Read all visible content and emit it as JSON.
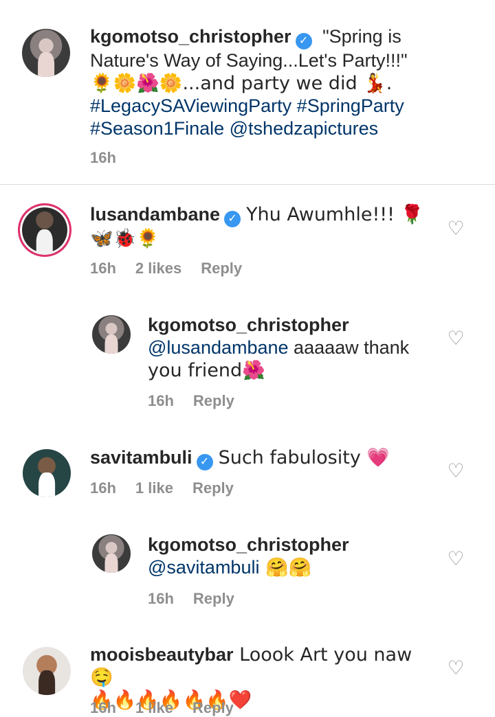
{
  "caption": {
    "username": "kgomotso_christopher",
    "text_line1": "\"Spring is",
    "text_line2": "Nature's Way of Saying...Let's Party!!!\"",
    "emoji_line": "🌻🌼🌺🌼...and party we did 💃.",
    "hashtags_line1": "#LegacySAViewingParty #SpringParty",
    "hashtags_line2": "#Season1Finale @tshedzapictures",
    "time": "16h"
  },
  "comments": [
    {
      "username": "lusandambane",
      "text": "Yhu Awumhle!!! 🌹",
      "text2": "🦋🐞🌻",
      "time": "16h",
      "likes": "2 likes",
      "reply": "Reply"
    },
    {
      "username": "kgomotso_christopher",
      "mention": "@lusandambane",
      "text": " aaaaaw thank",
      "text2": "you friend🌺",
      "time": "16h",
      "reply": "Reply"
    },
    {
      "username": "savitambuli",
      "text": "Such fabulosity 💗",
      "time": "16h",
      "likes": "1 like",
      "reply": "Reply"
    },
    {
      "username": "kgomotso_christopher",
      "mention": "@savitambuli",
      "text": " 🤗🤗",
      "time": "16h",
      "reply": "Reply"
    },
    {
      "username": "mooisbeautybar",
      "text": " Loook Art you naw 🤤",
      "text2": "🔥🔥🔥🔥🔥🔥❤️",
      "time": "16h",
      "likes": "1 like",
      "reply": "Reply"
    }
  ],
  "icons": {
    "verified": "✓",
    "heart": "♡"
  }
}
